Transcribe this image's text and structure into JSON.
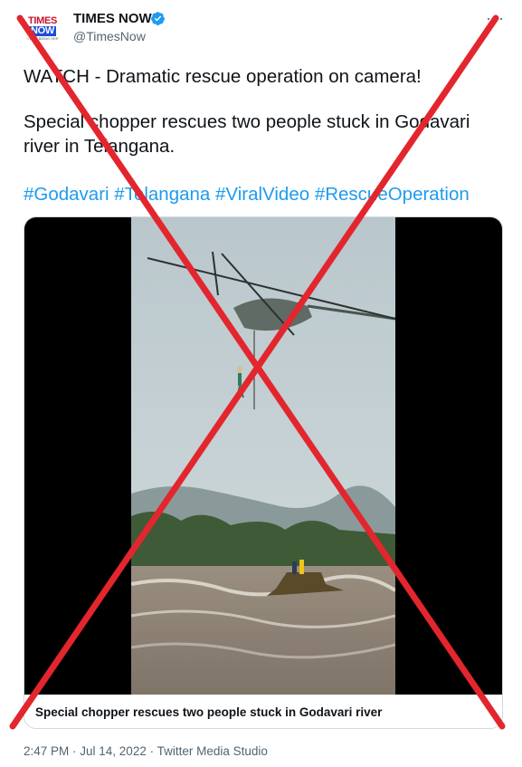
{
  "author": {
    "avatar_logo": {
      "line1": "TIMES",
      "line2": "NOW",
      "tagline": "ACTION BEING HERE"
    },
    "name": "TIMES NOW",
    "handle": "@TimesNow",
    "verified_icon": "verified-badge-icon"
  },
  "more_label": "···",
  "tweet": {
    "line1": "WATCH - Dramatic rescue operation on camera!",
    "line2": "Special chopper rescues two people stuck in Godavari",
    "line3": "river in Telangana.",
    "hashtags": [
      "#Godavari",
      "#Telangana",
      "#ViralVideo",
      "#RescueOperation"
    ]
  },
  "media": {
    "caption": "Special chopper rescues two people stuck in Godavari river"
  },
  "meta": {
    "timestamp": "2:47 PM · Jul 14, 2022 · Twitter Media Studio"
  },
  "colors": {
    "link": "#1d9bf0",
    "cross_overlay": "#e3262e",
    "verified": "#1d9bf0"
  }
}
